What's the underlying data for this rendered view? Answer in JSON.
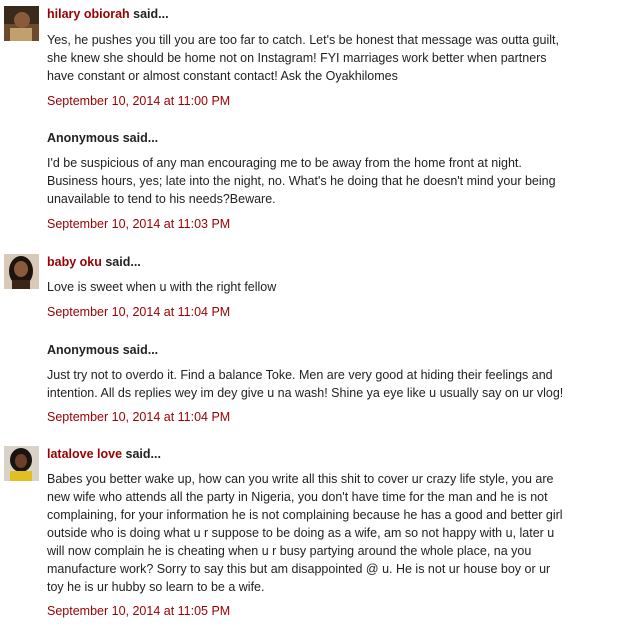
{
  "comments": [
    {
      "author": "hilary obiorah",
      "said": " said...",
      "body": [
        "Yes, he pushes you till you are too far to catch. Let's be honest that message was outta guilt,",
        "she knew she should be home not on Instagram! FYI marriages work better when partners",
        "have constant or almost constant contact! Ask the Oyakhilomes"
      ],
      "timestamp": "September 10, 2014 at 11:00 PM"
    },
    {
      "author": "Anonymous",
      "said": " said...",
      "body": [
        "I'd be suspicious of any man encouraging me to be away from the home front at night.",
        "Business hours, yes; late into the night, no. What's he doing that he doesn't mind your being",
        "unavailable to tend to his needs?Beware."
      ],
      "timestamp": "September 10, 2014 at 11:03 PM"
    },
    {
      "author": "baby oku",
      "said": " said...",
      "body": [
        "Love is sweet when u with the right fellow"
      ],
      "timestamp": "September 10, 2014 at 11:04 PM"
    },
    {
      "author": "Anonymous",
      "said": " said...",
      "body": [
        "Just try not to overdo it. Find a balance Toke. Men are very good at hiding their feelings and",
        "intention. All ds replies wey im dey give u na wash! Shine ya eye like u usually say on ur vlog!"
      ],
      "timestamp": "September 10, 2014 at 11:04 PM"
    },
    {
      "author": "latalove love",
      "said": " said...",
      "body": [
        "Babes you better wake up, how can you write all this shit to cover ur crazy life style, you are",
        "new wife who attends all the party in Nigeria, you don't have time for the man and he is not",
        "complaining, for your information he is not complaining because he has a good and better girl",
        "outside who is doing what u r suppose to be doing as a wife, am so not happy with u, later u",
        "will now complain he is cheating when u r busy partying around the whole place, na you",
        "manufacture work? Sorry to say this but am disappointed @ u. He is not ur house boy or ur",
        "toy he is ur hubby so learn to be a wife."
      ],
      "timestamp": "September 10, 2014 at 11:05 PM"
    }
  ],
  "colors": {
    "link": "#990000",
    "text": "#222222",
    "background": "#ffffff"
  },
  "icons": [
    "avatar-hilary-obiorah",
    "avatar-baby-oku",
    "avatar-latalove-love"
  ]
}
